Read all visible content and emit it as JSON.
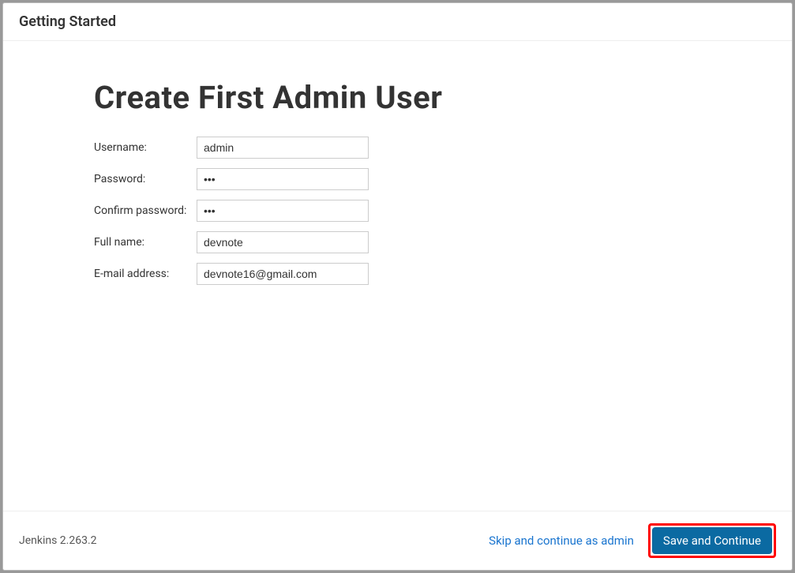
{
  "header": {
    "title": "Getting Started"
  },
  "main": {
    "title": "Create First Admin User"
  },
  "form": {
    "username_label": "Username:",
    "username_value": "admin",
    "password_label": "Password:",
    "password_value": "•••",
    "confirm_password_label": "Confirm password:",
    "confirm_password_value": "•••",
    "fullname_label": "Full name:",
    "fullname_value": "devnote",
    "email_label": "E-mail address:",
    "email_value": "devnote16@gmail.com"
  },
  "footer": {
    "version": "Jenkins 2.263.2",
    "skip_label": "Skip and continue as admin",
    "save_label": "Save and Continue"
  }
}
